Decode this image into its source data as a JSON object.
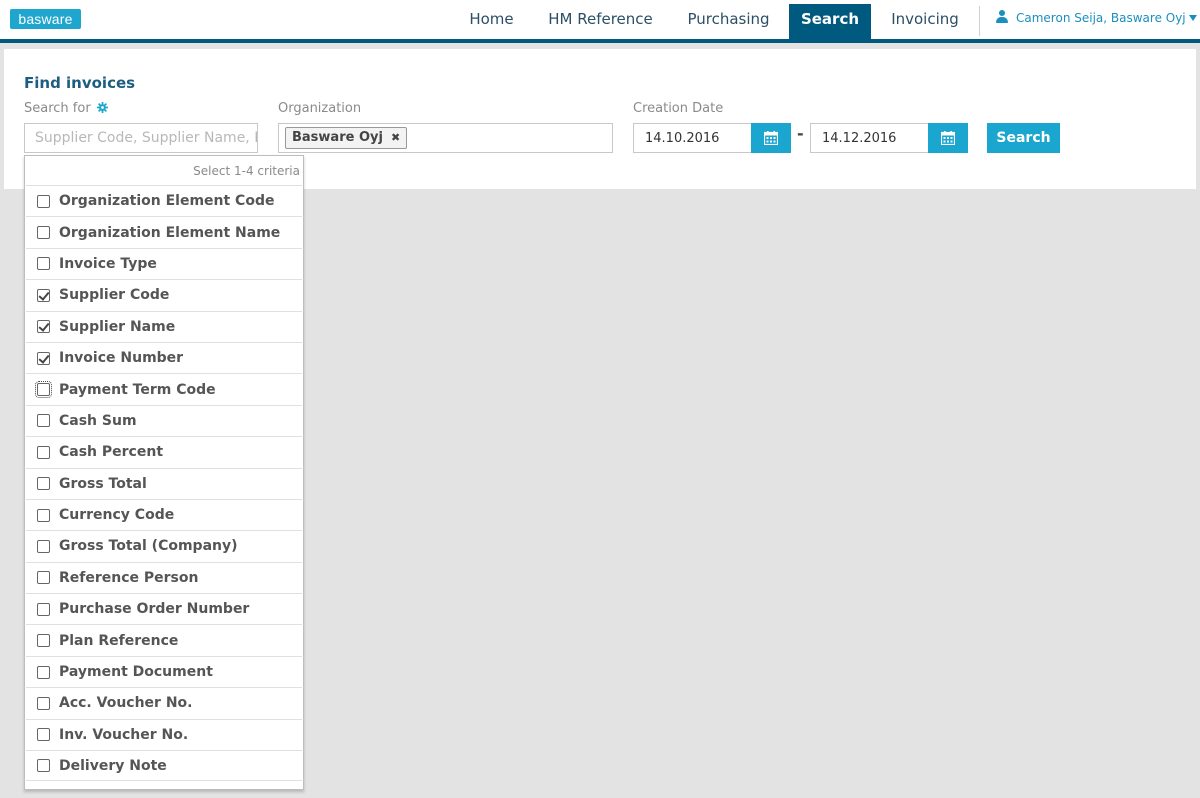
{
  "brand": {
    "logo_text": "basware"
  },
  "nav": {
    "items": [
      {
        "label": "Home"
      },
      {
        "label": "HM Reference"
      },
      {
        "label": "Purchasing"
      },
      {
        "label": "Search"
      },
      {
        "label": "Invoicing"
      }
    ],
    "active": "Search"
  },
  "user": {
    "name": "Cameron Seija, Basware Oyj",
    "icon": "user-icon"
  },
  "page": {
    "title": "Find invoices"
  },
  "search": {
    "label": "Search for",
    "settings_icon": "gear-icon",
    "placeholder": "Supplier Code, Supplier Name, Invoice Number",
    "value": ""
  },
  "organization": {
    "label": "Organization",
    "selected_tag": "Basware Oyj",
    "remove_icon": "close-icon"
  },
  "creation_date": {
    "label": "Creation Date",
    "from": "14.10.2016",
    "to": "14.12.2016",
    "separator": "-",
    "calendar_icon": "calendar-icon"
  },
  "search_button": {
    "label": "Search"
  },
  "criteria_dropdown": {
    "hint": "Select 1-4 criteria",
    "options": [
      {
        "label": "Organization Element Code",
        "checked": false
      },
      {
        "label": "Organization Element Name",
        "checked": false
      },
      {
        "label": "Invoice Type",
        "checked": false
      },
      {
        "label": "Supplier Code",
        "checked": true
      },
      {
        "label": "Supplier Name",
        "checked": true
      },
      {
        "label": "Invoice Number",
        "checked": true
      },
      {
        "label": "Payment Term Code",
        "checked": false,
        "focused": true
      },
      {
        "label": "Cash Sum",
        "checked": false
      },
      {
        "label": "Cash Percent",
        "checked": false
      },
      {
        "label": "Gross Total",
        "checked": false
      },
      {
        "label": "Currency Code",
        "checked": false
      },
      {
        "label": "Gross Total (Company)",
        "checked": false
      },
      {
        "label": "Reference Person",
        "checked": false
      },
      {
        "label": "Purchase Order Number",
        "checked": false
      },
      {
        "label": "Plan Reference",
        "checked": false
      },
      {
        "label": "Payment Document",
        "checked": false
      },
      {
        "label": "Acc. Voucher No.",
        "checked": false
      },
      {
        "label": "Inv. Voucher No.",
        "checked": false
      },
      {
        "label": "Delivery Note",
        "checked": false
      }
    ]
  },
  "colors": {
    "brand": "#1fa6cf",
    "nav_active": "#00597e",
    "accent": "#1aa6cf",
    "title": "#1d5e80"
  }
}
